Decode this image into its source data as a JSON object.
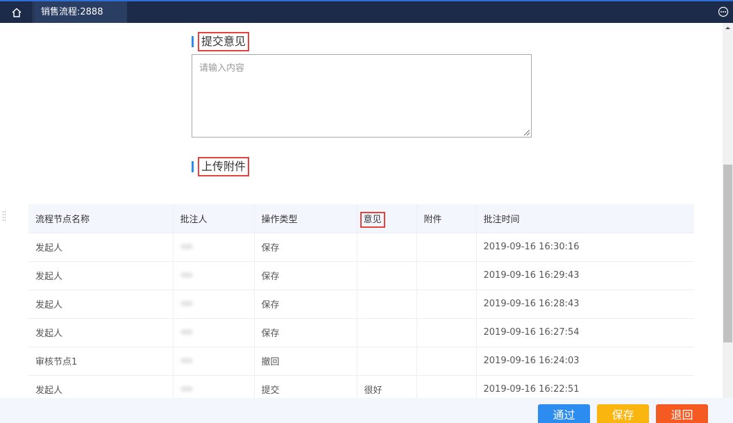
{
  "app": {
    "tab_title": "销售流程:2888"
  },
  "sections": {
    "opinion_title": "提交意见",
    "opinion_placeholder": "请输入内容",
    "attachment_title": "上传附件"
  },
  "table": {
    "headers": [
      "流程节点名称",
      "批注人",
      "操作类型",
      "意见",
      "附件",
      "批注时间"
    ],
    "rows": [
      {
        "node": "发起人",
        "operation": "保存",
        "opinion": "",
        "attachment": "",
        "time": "2019-09-16 16:30:16"
      },
      {
        "node": "发起人",
        "operation": "保存",
        "opinion": "",
        "attachment": "",
        "time": "2019-09-16 16:29:43"
      },
      {
        "node": "发起人",
        "operation": "保存",
        "opinion": "",
        "attachment": "",
        "time": "2019-09-16 16:28:43"
      },
      {
        "node": "发起人",
        "operation": "保存",
        "opinion": "",
        "attachment": "",
        "time": "2019-09-16 16:27:54"
      },
      {
        "node": "审核节点1",
        "operation": "撤回",
        "opinion": "",
        "attachment": "",
        "time": "2019-09-16 16:24:03"
      },
      {
        "node": "发起人",
        "operation": "提交",
        "opinion": "很好",
        "attachment": "",
        "time": "2019-09-16 16:22:51"
      }
    ]
  },
  "buttons": {
    "pass": "通过",
    "save": "保存",
    "back": "退回"
  },
  "colors": {
    "topbar": "#1c2b49",
    "accent": "#2d8cf0",
    "save": "#fbb50f",
    "back": "#f55a23",
    "highlight": "#e8403a"
  }
}
